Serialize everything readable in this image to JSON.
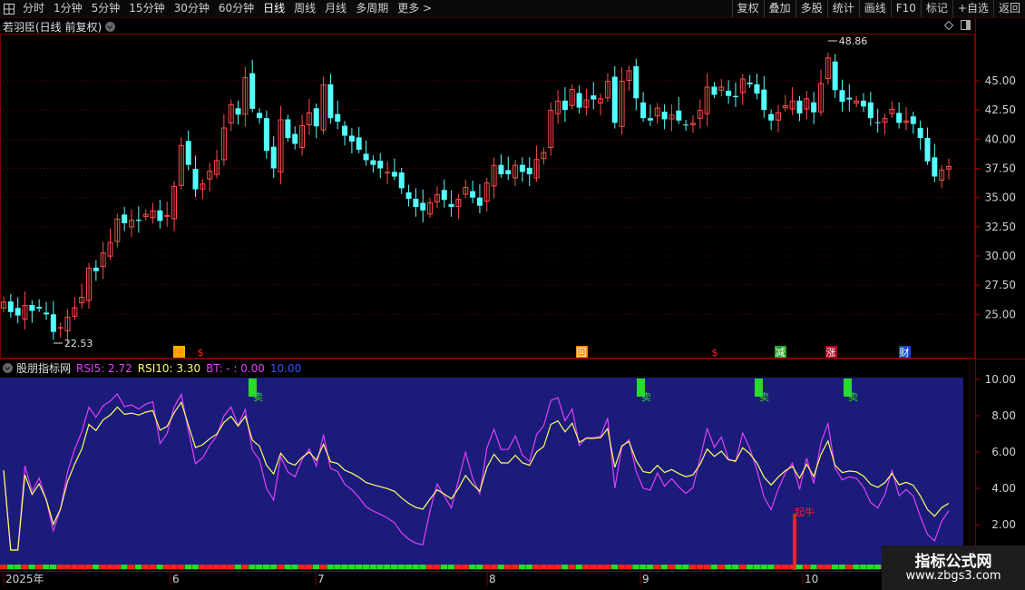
{
  "toolbar": {
    "periods": [
      "分时",
      "1分钟",
      "5分钟",
      "15分钟",
      "30分钟",
      "60分钟",
      "日线",
      "周线",
      "月线",
      "多周期",
      "更多 >"
    ],
    "active_period": "日线",
    "right_buttons": [
      "复权",
      "叠加",
      "多股",
      "统计",
      "画线",
      "F10",
      "标记",
      "+自选",
      "返回"
    ]
  },
  "main_chart": {
    "title": "若羽臣(日线 前复权)",
    "y_ticks": [
      "45.00",
      "42.50",
      "40.00",
      "37.50",
      "35.00",
      "32.50",
      "30.00",
      "27.50",
      "25.00"
    ],
    "high_label": "48.86",
    "low_label": "22.53",
    "markers": [
      {
        "text": "榜",
        "color": "#ff8a00",
        "box": "#ffb000"
      },
      {
        "text": "$",
        "color": "#ff2a2a",
        "box": ""
      },
      {
        "text": "回",
        "color": "#ffffff",
        "box": "#ff8a00"
      },
      {
        "text": "$",
        "color": "#ff2a2a",
        "box": ""
      },
      {
        "text": "减",
        "color": "#ffffff",
        "box": "#2ca02c"
      },
      {
        "text": "涨",
        "color": "#ffffff",
        "box": "#b00020"
      },
      {
        "text": "财",
        "color": "#ffffff",
        "box": "#1a3fd6"
      }
    ]
  },
  "indicator": {
    "name": "股朋指标网",
    "rsi5_label": "RSI5: 2.72",
    "rsi10_label": "RSI10: 3.30",
    "bt_label": "BT: - : 0.00",
    "extra_label": "10.00",
    "y_ticks": [
      "10.00",
      "8.00",
      "6.00",
      "4.00",
      "2.00"
    ],
    "sell_label": "卖",
    "bull_label": "起牛",
    "colors": {
      "rsi5": "#e040fb",
      "rsi10": "#ffff66",
      "panel_bg": "#1b1b7a"
    }
  },
  "x_axis": [
    "2025年",
    "6",
    "7",
    "8",
    "9",
    "10"
  ],
  "watermark": {
    "title": "指标公式网",
    "url": "www.zbgs3.com"
  },
  "chart_data": {
    "type": "candlestick",
    "ylim": [
      23,
      49
    ],
    "closes": [
      26.1,
      25.2,
      24.9,
      25.8,
      25.3,
      25.5,
      25.0,
      23.5,
      23.9,
      24.8,
      25.6,
      26.5,
      29.0,
      28.7,
      30.3,
      31.2,
      33.2,
      32.8,
      33.1,
      33.0,
      33.6,
      33.9,
      33.0,
      33.5,
      36.0,
      39.5,
      37.8,
      35.7,
      36.2,
      37.3,
      38.2,
      41.0,
      43.0,
      42.1,
      45.3,
      42.6,
      41.8,
      39.0,
      37.5,
      41.7,
      40.1,
      39.6,
      41.2,
      42.3,
      41.1,
      44.7,
      41.8,
      41.5,
      40.3,
      39.8,
      39.1,
      38.2,
      37.8,
      37.5,
      37.2,
      36.8,
      35.8,
      34.9,
      34.2,
      33.9,
      34.6,
      35.3,
      34.8,
      34.2,
      34.9,
      35.9,
      35.0,
      34.3,
      36.3,
      37.8,
      37.0,
      37.0,
      37.8,
      37.2,
      37.0,
      38.3,
      38.9,
      42.5,
      43.3,
      42.5,
      44.3,
      42.7,
      43.4,
      43.4,
      43.5,
      45.0,
      41.4,
      45.0,
      45.9,
      43.5,
      41.8,
      41.6,
      42.7,
      41.7,
      42.1,
      41.6,
      41.2,
      41.4,
      42.5,
      44.5,
      43.8,
      44.5,
      43.7,
      43.6,
      45.2,
      44.7,
      43.9,
      42.5,
      41.6,
      42.3,
      42.9,
      43.3,
      42.2,
      43.5,
      42.3,
      44.8,
      47.0,
      44.2,
      43.2,
      43.4,
      43.3,
      42.8,
      41.8,
      41.4,
      41.8,
      42.6,
      41.4,
      41.6,
      41.3,
      40.1,
      38.1,
      36.8,
      37.4,
      37.7
    ]
  }
}
